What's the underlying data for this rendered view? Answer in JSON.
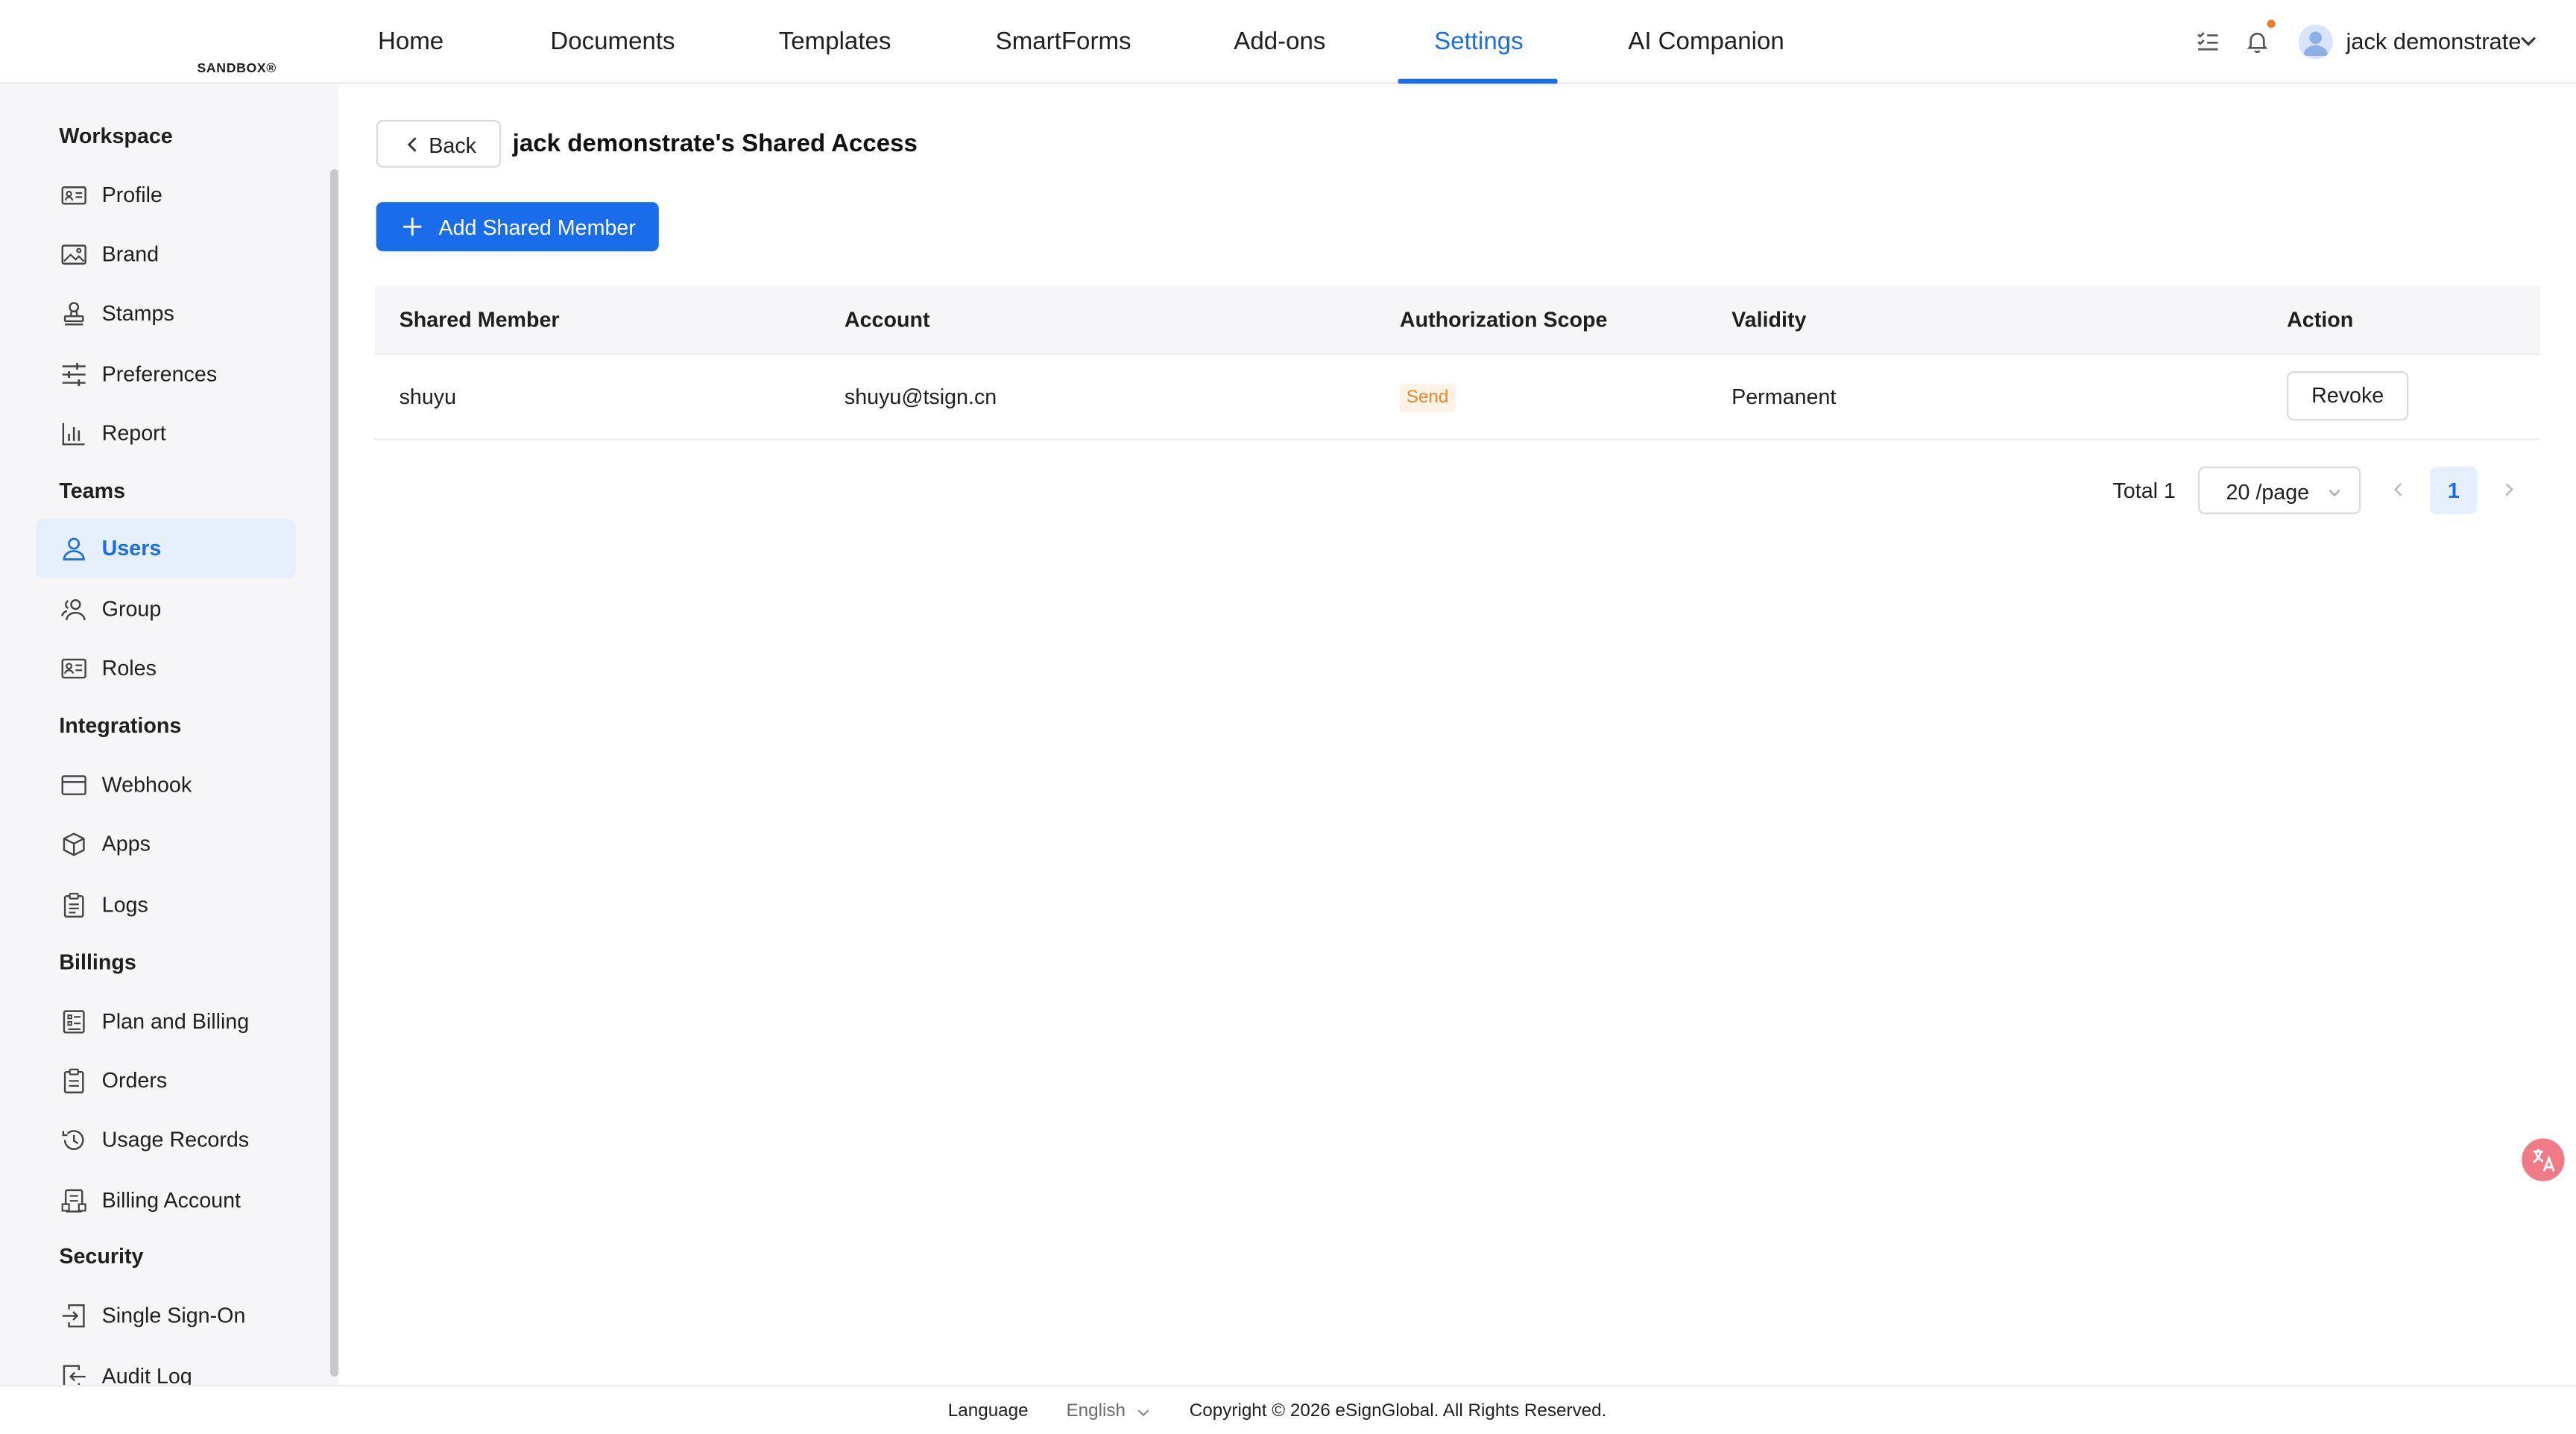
{
  "header": {
    "logo_label": "SANDBOX®",
    "tabs": [
      {
        "label": "Home"
      },
      {
        "label": "Documents"
      },
      {
        "label": "Templates"
      },
      {
        "label": "SmartForms"
      },
      {
        "label": "Add-ons"
      },
      {
        "label": "Settings",
        "active": true
      },
      {
        "label": "AI Companion"
      }
    ],
    "user_name": "jack demonstrate",
    "has_notification": true
  },
  "sidebar": {
    "sections": [
      {
        "title": "Workspace",
        "items": [
          {
            "label": "Profile",
            "icon": "id-card-icon"
          },
          {
            "label": "Brand",
            "icon": "image-icon"
          },
          {
            "label": "Stamps",
            "icon": "stamp-icon"
          },
          {
            "label": "Preferences",
            "icon": "sliders-icon"
          },
          {
            "label": "Report",
            "icon": "bar-chart-icon"
          }
        ]
      },
      {
        "title": "Teams",
        "items": [
          {
            "label": "Users",
            "icon": "user-icon",
            "active": true
          },
          {
            "label": "Group",
            "icon": "group-icon"
          },
          {
            "label": "Roles",
            "icon": "role-card-icon"
          }
        ]
      },
      {
        "title": "Integrations",
        "items": [
          {
            "label": "Webhook",
            "icon": "browser-window-icon"
          },
          {
            "label": "Apps",
            "icon": "cube-icon"
          },
          {
            "label": "Logs",
            "icon": "clipboard-list-icon"
          }
        ]
      },
      {
        "title": "Billings",
        "items": [
          {
            "label": "Plan and Billing",
            "icon": "plan-list-icon"
          },
          {
            "label": "Orders",
            "icon": "clipboard-icon"
          },
          {
            "label": "Usage Records",
            "icon": "history-clock-icon"
          },
          {
            "label": "Billing Account",
            "icon": "billing-account-icon"
          }
        ]
      },
      {
        "title": "Security",
        "items": [
          {
            "label": "Single Sign-On",
            "icon": "sign-in-icon"
          },
          {
            "label": "Audit Log",
            "icon": "sign-out-icon"
          }
        ]
      }
    ]
  },
  "main": {
    "back_label": "Back",
    "title": "jack demonstrate's Shared Access",
    "add_button_label": "Add Shared Member",
    "table": {
      "columns": [
        "Shared Member",
        "Account",
        "Authorization Scope",
        "Validity",
        "Action"
      ],
      "rows": [
        {
          "member": "shuyu",
          "account": "shuyu@tsign.cn",
          "scope": "Send",
          "validity": "Permanent",
          "action": "Revoke"
        }
      ]
    },
    "pagination": {
      "total_label": "Total 1",
      "page_size": "20 /page",
      "current_page": "1"
    }
  },
  "footer": {
    "language_label": "Language",
    "language_value": "English",
    "copyright": "Copyright © 2026 eSignGlobal. All Rights Reserved."
  },
  "colors": {
    "accent": "#1a6dea",
    "active_bg": "#e6effc",
    "sidebar_bg": "#f6f6f8",
    "scope_tag_text": "#e8872a",
    "scope_tag_bg": "#fdf3e4",
    "notification_dot": "#f07b2a",
    "translate_fab": "#f07a86"
  }
}
